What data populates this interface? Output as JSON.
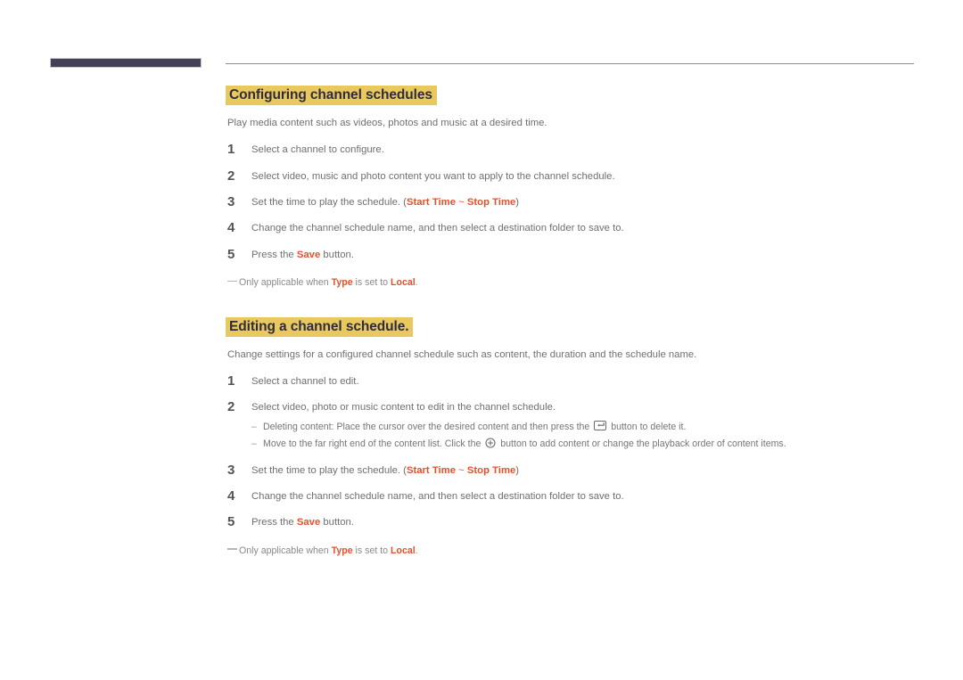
{
  "colors": {
    "accent_orange": "#e8502a",
    "highlight_yellow": "#e9c95e",
    "heading_text": "#2f2b40",
    "body_text": "#6f6f6f",
    "header_bar": "#454055"
  },
  "sections": [
    {
      "heading": "Configuring channel schedules",
      "intro": "Play media content such as videos, photos and music at a desired time.",
      "steps": [
        {
          "num": "1",
          "pre": "Select a channel to configure.",
          "accent1": "",
          "mid": "",
          "accent2": "",
          "post": ""
        },
        {
          "num": "2",
          "pre": "Select video, music and photo content you want to apply to the channel schedule.",
          "accent1": "",
          "mid": "",
          "accent2": "",
          "post": ""
        },
        {
          "num": "3",
          "pre": "Set the time to play the schedule. (",
          "accent1": "Start Time",
          "mid": " ~ ",
          "accent2": "Stop Time",
          "post": ")"
        },
        {
          "num": "4",
          "pre": "Change the channel schedule name, and then select a destination folder to save to.",
          "accent1": "",
          "mid": "",
          "accent2": "",
          "post": ""
        },
        {
          "num": "5",
          "pre": "Press the ",
          "accent1": "Save",
          "mid": " button.",
          "accent2": "",
          "post": ""
        }
      ],
      "note": {
        "pre": "Only applicable when ",
        "accent1": "Type",
        "mid": " is set to ",
        "accent2": "Local",
        "post": "."
      }
    },
    {
      "heading": "Editing a channel schedule.",
      "intro": "Change settings for a configured channel schedule such as content, the duration and the schedule name.",
      "steps": [
        {
          "num": "1",
          "pre": "Select a channel to edit.",
          "accent1": "",
          "mid": "",
          "accent2": "",
          "post": ""
        },
        {
          "num": "2",
          "pre": "Select video, photo or music content to edit in the channel schedule.",
          "accent1": "",
          "mid": "",
          "accent2": "",
          "post": ""
        },
        {
          "num": "3",
          "pre": "Set the time to play the schedule. (",
          "accent1": "Start Time",
          "mid": " ~ ",
          "accent2": "Stop Time",
          "post": ")"
        },
        {
          "num": "4",
          "pre": "Change the channel schedule name, and then select a destination folder to save to.",
          "accent1": "",
          "mid": "",
          "accent2": "",
          "post": ""
        },
        {
          "num": "5",
          "pre": "Press the ",
          "accent1": "Save",
          "mid": " button.",
          "accent2": "",
          "post": ""
        }
      ],
      "subitems": [
        {
          "dash": "–",
          "pre": "Deleting content: Place the cursor over the desired content and then press the ",
          "icon": "enter-key-icon",
          "post": " button to delete it."
        },
        {
          "dash": "–",
          "pre": "Move to the far right end of the content list. Click the ",
          "icon": "plus-circle-icon",
          "post": " button to add content or change the playback order of content items."
        }
      ],
      "note": {
        "pre": "Only applicable when ",
        "accent1": "Type",
        "mid": " is set to ",
        "accent2": "Local",
        "post": "."
      }
    }
  ]
}
